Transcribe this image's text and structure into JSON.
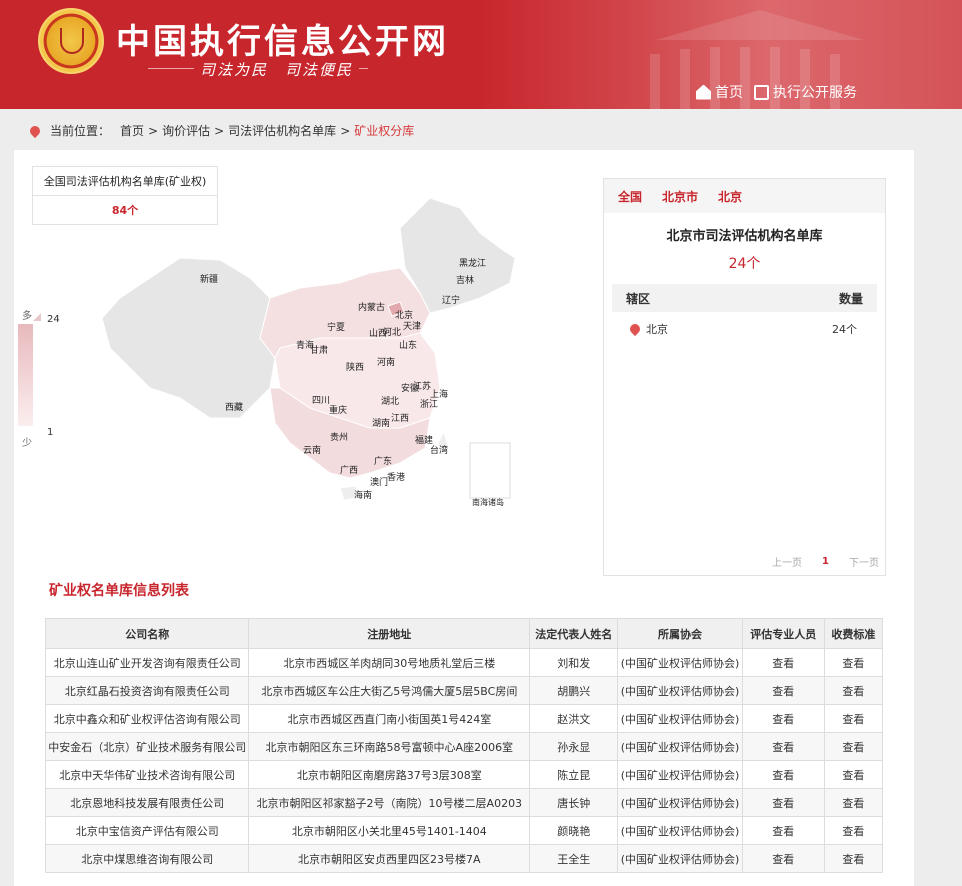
{
  "header": {
    "site_title": "中国执行信息公开网",
    "slogan": "司法为民　司法便民",
    "nav": {
      "home": "首页",
      "service": "执行公开服务"
    }
  },
  "breadcrumb": {
    "prefix": "当前位置：",
    "items": [
      "首页",
      ">",
      "询价评估",
      ">",
      "司法评估机构名单库",
      ">"
    ],
    "current": "矿业权分库"
  },
  "national": {
    "title": "全国司法评估机构名单库(矿业权)",
    "count": "84个"
  },
  "legend": {
    "high_label": "多",
    "high_value": "24",
    "low_value": "1",
    "low_label": "少"
  },
  "map": {
    "provinces": [
      "新疆",
      "西藏",
      "青海",
      "甘肃",
      "宁夏",
      "内蒙古",
      "黑龙江",
      "吉林",
      "辽宁",
      "北京",
      "天津",
      "河北",
      "山西",
      "山东",
      "河南",
      "陕西",
      "四川",
      "重庆",
      "湖北",
      "安徽",
      "江苏",
      "上海",
      "浙江",
      "湖南",
      "江西",
      "福建",
      "台湾",
      "贵州",
      "云南",
      "广西",
      "广东",
      "香港",
      "澳门",
      "海南"
    ],
    "inset_label": "南海诸岛"
  },
  "region": {
    "tabs": [
      "全国",
      "北京市",
      "北京"
    ],
    "title": "北京市司法评估机构名单库",
    "count": "24个",
    "col_district": "辖区",
    "col_count": "数量",
    "rows": [
      {
        "name": "北京",
        "count": "24个"
      }
    ],
    "pager": {
      "prev": "上一页",
      "current": "1",
      "next": "下一页"
    }
  },
  "list": {
    "title": "矿业权名单库信息列表",
    "columns": [
      "公司名称",
      "注册地址",
      "法定代表人姓名",
      "所属协会",
      "评估专业人员",
      "收费标准"
    ],
    "rows": [
      [
        "北京山连山矿业开发咨询有限责任公司",
        "北京市西城区羊肉胡同30号地质礼堂后三楼",
        "刘和发",
        "(中国矿业权评估师协会)",
        "查看",
        "查看"
      ],
      [
        "北京红晶石投资咨询有限责任公司",
        "北京市西城区车公庄大街乙5号鸿儒大厦5层5BC房间",
        "胡鹏兴",
        "(中国矿业权评估师协会)",
        "查看",
        "查看"
      ],
      [
        "北京中鑫众和矿业权评估咨询有限公司",
        "北京市西城区西直门南小街国英1号424室",
        "赵洪文",
        "(中国矿业权评估师协会)",
        "查看",
        "查看"
      ],
      [
        "中安金石（北京）矿业技术服务有限公司",
        "北京市朝阳区东三环南路58号富顿中心A座2006室",
        "孙永显",
        "(中国矿业权评估师协会)",
        "查看",
        "查看"
      ],
      [
        "北京中天华伟矿业技术咨询有限公司",
        "北京市朝阳区南磨房路37号3层308室",
        "陈立昆",
        "(中国矿业权评估师协会)",
        "查看",
        "查看"
      ],
      [
        "北京恩地科技发展有限责任公司",
        "北京市朝阳区祁家豁子2号（南院）10号楼二层A0203",
        "唐长钟",
        "(中国矿业权评估师协会)",
        "查看",
        "查看"
      ],
      [
        "北京中宝信资产评估有限公司",
        "北京市朝阳区小关北里45号1401-1404",
        "颜晓艳",
        "(中国矿业权评估师协会)",
        "查看",
        "查看"
      ],
      [
        "北京中煤思维咨询有限公司",
        "北京市朝阳区安贞西里四区23号楼7A",
        "王全生",
        "(中国矿业权评估师协会)",
        "查看",
        "查看"
      ]
    ]
  },
  "colors": {
    "brand_red": "#c8262d",
    "map_high": "#e8b9bd",
    "map_low": "#fbeeee",
    "map_none": "#e6e6e6"
  }
}
